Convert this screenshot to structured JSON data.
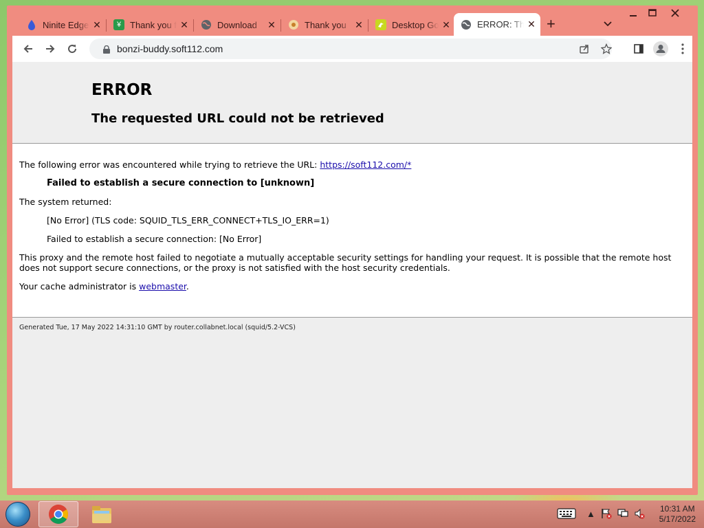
{
  "browser": {
    "tabs": [
      {
        "title": "Ninite Edge",
        "icon": "ninite-icon",
        "active": false
      },
      {
        "title": "Thank you f",
        "icon": "softonic-icon",
        "active": false
      },
      {
        "title": "Download",
        "icon": "globe-icon",
        "active": false
      },
      {
        "title": "Thank you",
        "icon": "app-icon",
        "active": false
      },
      {
        "title": "Desktop Go",
        "icon": "desktopgoose-icon",
        "active": false
      },
      {
        "title": "ERROR: The",
        "icon": "globe-icon",
        "active": true
      }
    ],
    "new_tab_label": "+",
    "address": "bonzi-buddy.soft112.com"
  },
  "page": {
    "title": "ERROR",
    "subtitle": "The requested URL could not be retrieved",
    "intro": "The following error was encountered while trying to retrieve the URL: ",
    "intro_url": "https://soft112.com/*",
    "failed_bold": "Failed to establish a secure connection to [unknown]",
    "system_returned": "The system returned:",
    "tls_code": "[No Error] (TLS code: SQUID_TLS_ERR_CONNECT+TLS_IO_ERR=1)",
    "failed_detail": "Failed to establish a secure connection: [No Error]",
    "explanation": "This proxy and the remote host failed to negotiate a mutually acceptable security settings for handling your request. It is possible that the remote host does not support secure connections, or the proxy is not satisfied with the host security credentials.",
    "admin_prefix": "Your cache administrator is ",
    "admin_link": "webmaster",
    "admin_suffix": ".",
    "footer": "Generated Tue, 17 May 2022 14:31:10 GMT by router.collabnet.local (squid/5.2-VCS)"
  },
  "taskbar": {
    "time": "10:31 AM",
    "date": "5/17/2022"
  }
}
